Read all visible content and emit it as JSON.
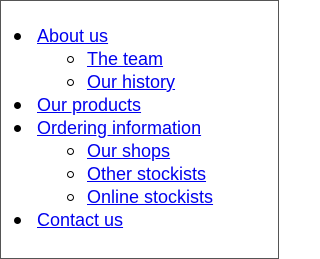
{
  "nav": {
    "items": [
      {
        "label": "About us",
        "children": [
          {
            "label": "The team"
          },
          {
            "label": "Our history"
          }
        ]
      },
      {
        "label": "Our products"
      },
      {
        "label": "Ordering information",
        "children": [
          {
            "label": "Our shops"
          },
          {
            "label": "Other stockists"
          },
          {
            "label": "Online stockists"
          }
        ]
      },
      {
        "label": "Contact us"
      }
    ]
  },
  "colors": {
    "link": "#0000ee",
    "text": "#000000",
    "background": "#ffffff"
  },
  "icons": {
    "top_level_bullet": "disc-bullet",
    "sub_level_bullet": "circle-bullet"
  }
}
